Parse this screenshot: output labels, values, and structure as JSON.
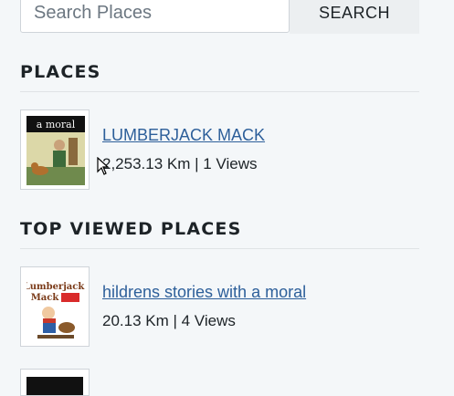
{
  "search": {
    "placeholder": "Search Places",
    "button_label": "SEARCH"
  },
  "places": {
    "heading": "PLACES",
    "items": [
      {
        "thumb_caption": "a moral",
        "title": "LUMBERJACK MACK",
        "meta": "2,253.13 Km | 1 Views"
      }
    ]
  },
  "top_viewed": {
    "heading": "TOP VIEWED PLACES",
    "items": [
      {
        "thumb_caption_line1": "Lumberjack",
        "thumb_caption_line2": "Mack",
        "title": "hildrens stories with a moral",
        "meta": "20.13 Km | 4 Views"
      }
    ]
  }
}
